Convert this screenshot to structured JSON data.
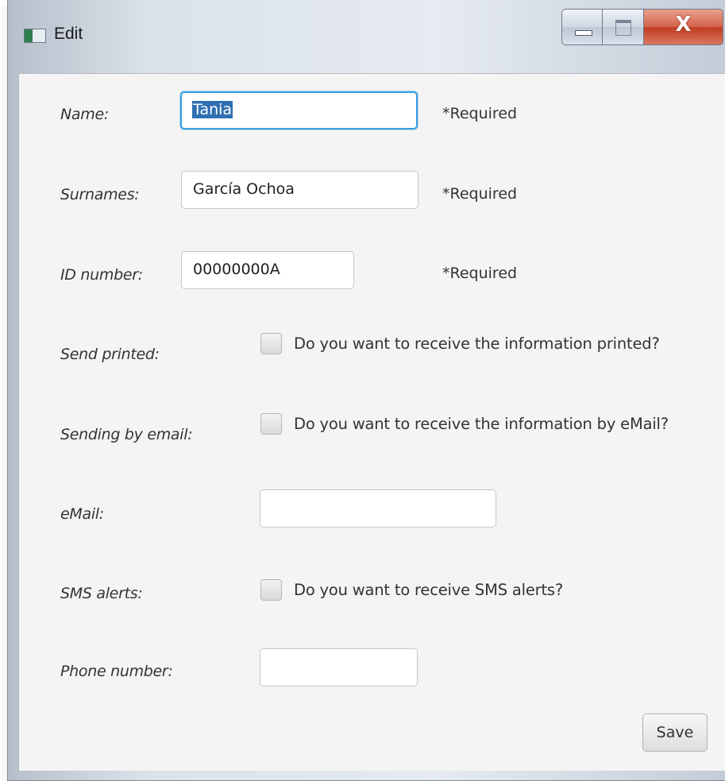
{
  "window": {
    "title": "Edit",
    "close_symbol": "X"
  },
  "form": {
    "name": {
      "label": "Name:",
      "value": "Tania",
      "required": "*Required"
    },
    "surnames": {
      "label": "Surnames:",
      "value": "García Ochoa",
      "required": "*Required"
    },
    "id_number": {
      "label": "ID number:",
      "value": "00000000A",
      "required": "*Required"
    },
    "send_printed": {
      "label": "Send printed:",
      "option": "Do you want to receive the information printed?",
      "checked": false
    },
    "send_email": {
      "label": "Sending by email:",
      "option": "Do you want to receive the information by eMail?",
      "checked": false
    },
    "email": {
      "label": "eMail:",
      "value": ""
    },
    "sms_alerts": {
      "label": "SMS alerts:",
      "option": "Do you want to receive SMS alerts?",
      "checked": false
    },
    "phone": {
      "label": "Phone number:",
      "value": ""
    },
    "save_label": "Save"
  },
  "colors": {
    "focus_border": "#3b9ddb",
    "selection": "#2f6fb2",
    "close_button": "#c23b22"
  }
}
